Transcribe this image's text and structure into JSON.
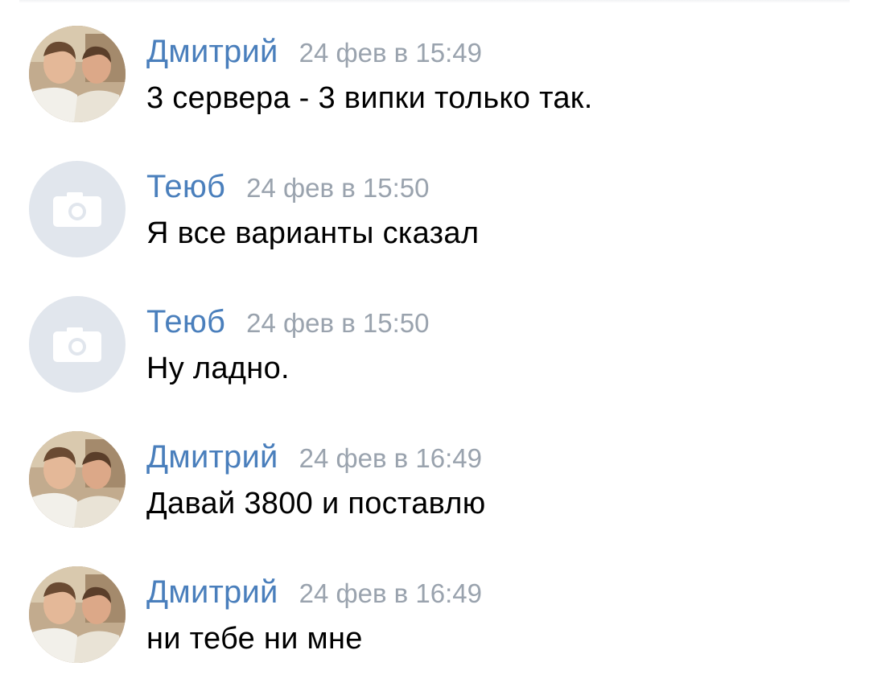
{
  "messages": [
    {
      "author": "Дмитрий",
      "time": "24 фев в 15:49",
      "text": "3 сервера - 3 випки только так.",
      "avatar": "photo-avatar"
    },
    {
      "author": "Теюб",
      "time": "24 фев в 15:50",
      "text": "Я все варианты сказал",
      "avatar": "camera-icon"
    },
    {
      "author": "Теюб",
      "time": "24 фев в 15:50",
      "text": "Ну ладно.",
      "avatar": "camera-icon"
    },
    {
      "author": "Дмитрий",
      "time": "24 фев в 16:49",
      "text": "Давай 3800 и поставлю",
      "avatar": "photo-avatar"
    },
    {
      "author": "Дмитрий",
      "time": "24 фев в 16:49",
      "text": "ни тебе ни мне",
      "avatar": "photo-avatar"
    }
  ],
  "colors": {
    "author": "#4a7fbc",
    "time": "#9aa3ae",
    "text": "#000000",
    "empty_avatar": "#e1e6ed",
    "camera_icon": "#ffffff"
  }
}
